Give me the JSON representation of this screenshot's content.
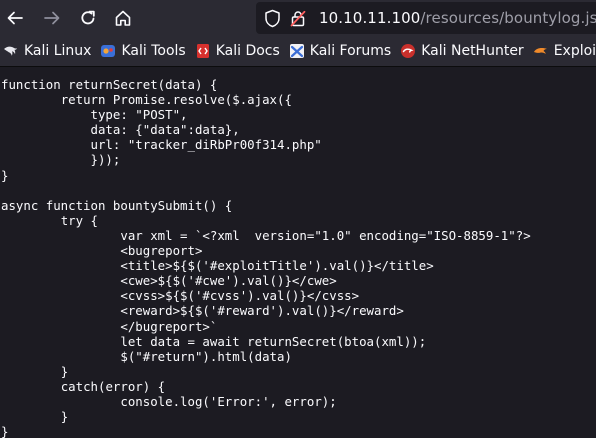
{
  "url": {
    "host": "10.10.11.100",
    "path": "/resources/bountylog.js"
  },
  "bookmarks": [
    {
      "label": "Kali Linux",
      "icon": "kali-dragon-icon"
    },
    {
      "label": "Kali Tools",
      "icon": "kali-tools-icon"
    },
    {
      "label": "Kali Docs",
      "icon": "kali-docs-icon"
    },
    {
      "label": "Kali Forums",
      "icon": "kali-forums-icon"
    },
    {
      "label": "Kali NetHunter",
      "icon": "kali-nethunter-icon"
    },
    {
      "label": "Exploit-",
      "icon": "exploit-db-icon"
    }
  ],
  "code_lines": [
    "function returnSecret(data) {",
    "\treturn Promise.resolve($.ajax({",
    "            type: \"POST\",",
    "            data: {\"data\":data},",
    "            url: \"tracker_diRbPr00f314.php\"",
    "            }));",
    "}",
    "",
    "async function bountySubmit() {",
    "\ttry {",
    "\t\tvar xml = `<?xml  version=\"1.0\" encoding=\"ISO-8859-1\"?>",
    "\t\t<bugreport>",
    "\t\t<title>${$('#exploitTitle').val()}</title>",
    "\t\t<cwe>${$('#cwe').val()}</cwe>",
    "\t\t<cvss>${$('#cvss').val()}</cvss>",
    "\t\t<reward>${$('#reward').val()}</reward>",
    "\t\t</bugreport>`",
    "\t\tlet data = await returnSecret(btoa(xml));",
    "  \t\t$(\"#return\").html(data)",
    "\t}",
    "\tcatch(error) {",
    "\t\tconsole.log('Error:', error);",
    "\t}",
    "}"
  ]
}
